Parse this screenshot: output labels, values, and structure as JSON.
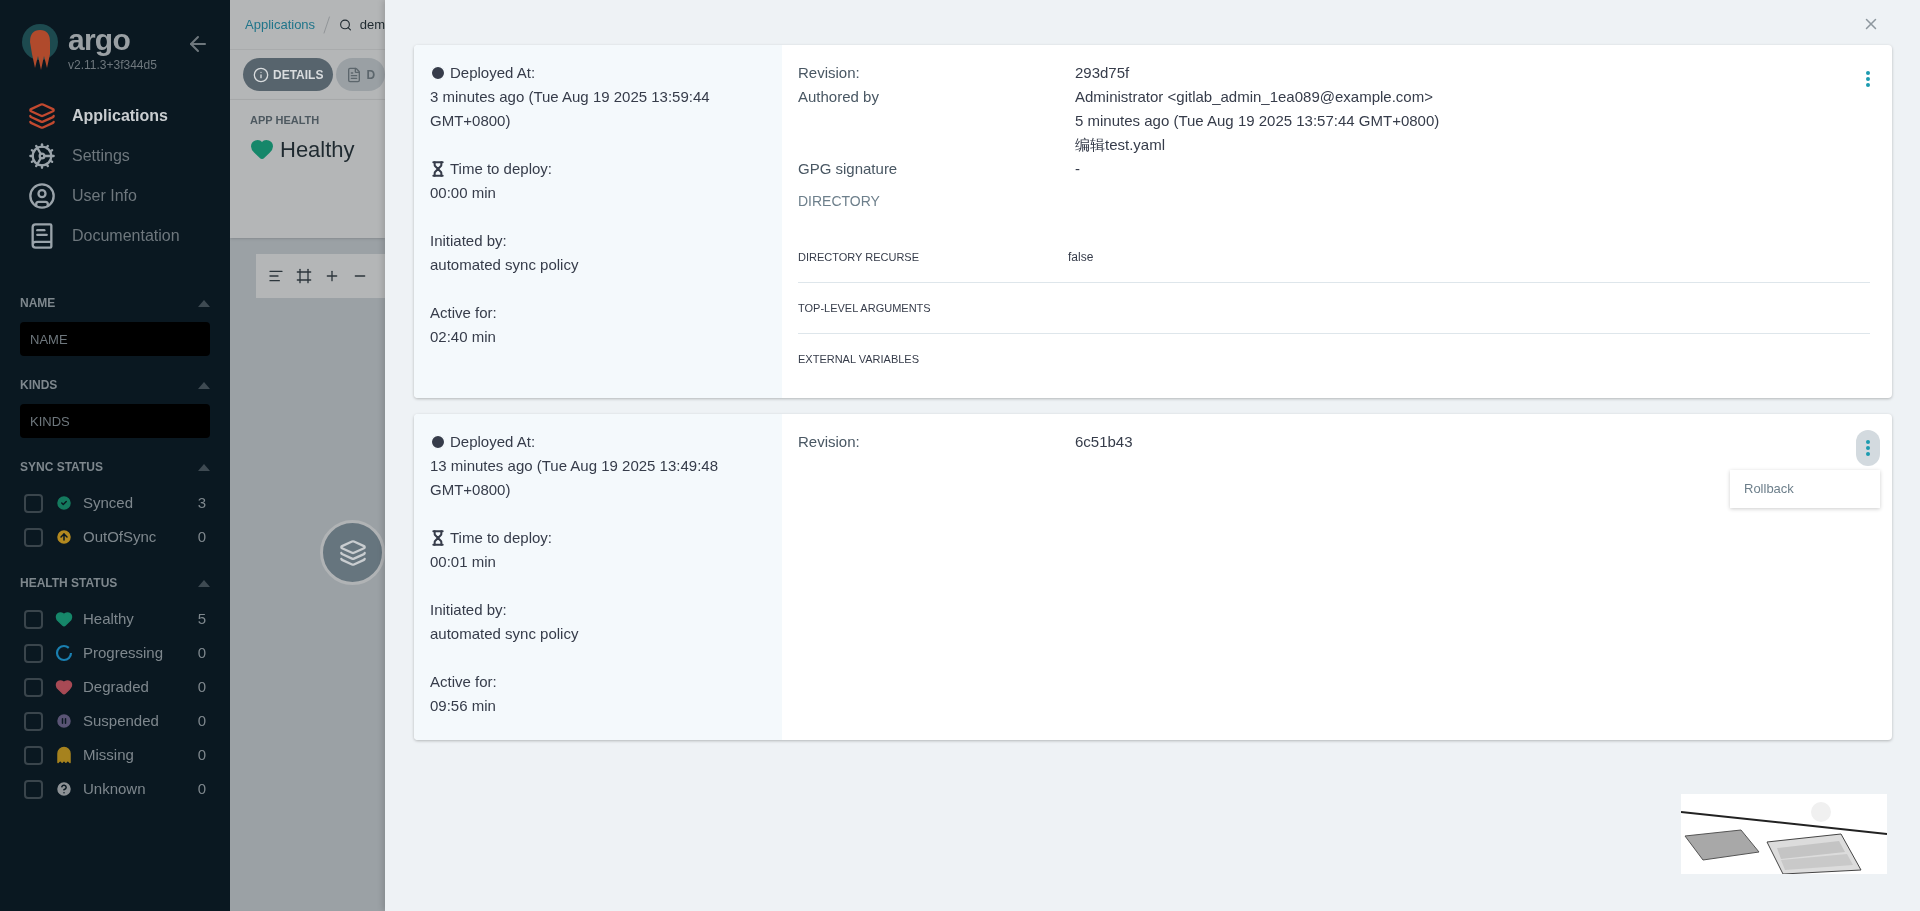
{
  "sidebar": {
    "logo_text": "argo",
    "version": "v2.11.3+3f344d5",
    "nav": [
      {
        "label": "Applications",
        "selected": true,
        "kind": "apps"
      },
      {
        "label": "Settings",
        "selected": false,
        "kind": "settings"
      },
      {
        "label": "User Info",
        "selected": false,
        "kind": "user"
      },
      {
        "label": "Documentation",
        "selected": false,
        "kind": "docs"
      }
    ],
    "filters": [
      {
        "title": "NAME",
        "kind": "input",
        "placeholder": "NAME"
      },
      {
        "title": "KINDS",
        "kind": "input",
        "placeholder": "KINDS"
      },
      {
        "title": "SYNC STATUS",
        "kind": "checks",
        "items": [
          {
            "label": "Synced",
            "count": "3",
            "checked": false,
            "kind": "synced"
          },
          {
            "label": "OutOfSync",
            "count": "0",
            "checked": false,
            "kind": "outofsync"
          }
        ]
      },
      {
        "title": "HEALTH STATUS",
        "kind": "checks",
        "items": [
          {
            "label": "Healthy",
            "count": "5",
            "checked": false,
            "kind": "healthy"
          },
          {
            "label": "Progressing",
            "count": "0",
            "checked": false,
            "kind": "progressing"
          },
          {
            "label": "Degraded",
            "count": "0",
            "checked": false,
            "kind": "degraded"
          },
          {
            "label": "Suspended",
            "count": "0",
            "checked": false,
            "kind": "suspended"
          },
          {
            "label": "Missing",
            "count": "0",
            "checked": false,
            "kind": "missing"
          },
          {
            "label": "Unknown",
            "count": "0",
            "checked": false,
            "kind": "unknown"
          }
        ]
      }
    ]
  },
  "background": {
    "breadcrumb": "Applications",
    "search_text": "dem",
    "tabs": [
      {
        "label": "DETAILS",
        "selected": true,
        "kind": "info"
      },
      {
        "label": "D",
        "selected": false,
        "kind": "file"
      }
    ],
    "app_health": {
      "label": "APP HEALTH",
      "value": "Healthy"
    }
  },
  "history": [
    {
      "deployed_label": "Deployed At:",
      "deployed_at": "3 minutes ago (Tue Aug 19 2025 13:59:44 GMT+0800)",
      "deploy_time_label": "Time to deploy:",
      "deploy_time": "00:00 min",
      "initiated_label": "Initiated by:",
      "initiated_by": "automated sync policy",
      "active_label": "Active for:",
      "active_for": "02:40 min",
      "details": [
        {
          "label": "Revision:",
          "values": [
            "293d75f"
          ]
        },
        {
          "label": "Authored by",
          "values": [
            "Administrator <gitlab_admin_1ea089@example.com>",
            "5 minutes ago (Tue Aug 19 2025 13:57:44 GMT+0800)",
            "编辑test.yaml"
          ]
        },
        {
          "label": "GPG signature",
          "values": [
            "-"
          ]
        }
      ],
      "source_heading": "DIRECTORY",
      "source_rows": [
        {
          "label": "DIRECTORY RECURSE",
          "value": "false"
        },
        {
          "label": "TOP-LEVEL ARGUMENTS"
        },
        {
          "label": "EXTERNAL VARIABLES"
        }
      ],
      "menu_open": false
    },
    {
      "deployed_label": "Deployed At:",
      "deployed_at": "13 minutes ago (Tue Aug 19 2025 13:49:48 GMT+0800)",
      "deploy_time_label": "Time to deploy:",
      "deploy_time": "00:01 min",
      "initiated_label": "Initiated by:",
      "initiated_by": "automated sync policy",
      "active_label": "Active for:",
      "active_for": "09:56 min",
      "details": [
        {
          "label": "Revision:",
          "values": [
            "6c51b43"
          ]
        }
      ],
      "menu_open": true,
      "menu_items": [
        "Rollback"
      ]
    }
  ]
}
